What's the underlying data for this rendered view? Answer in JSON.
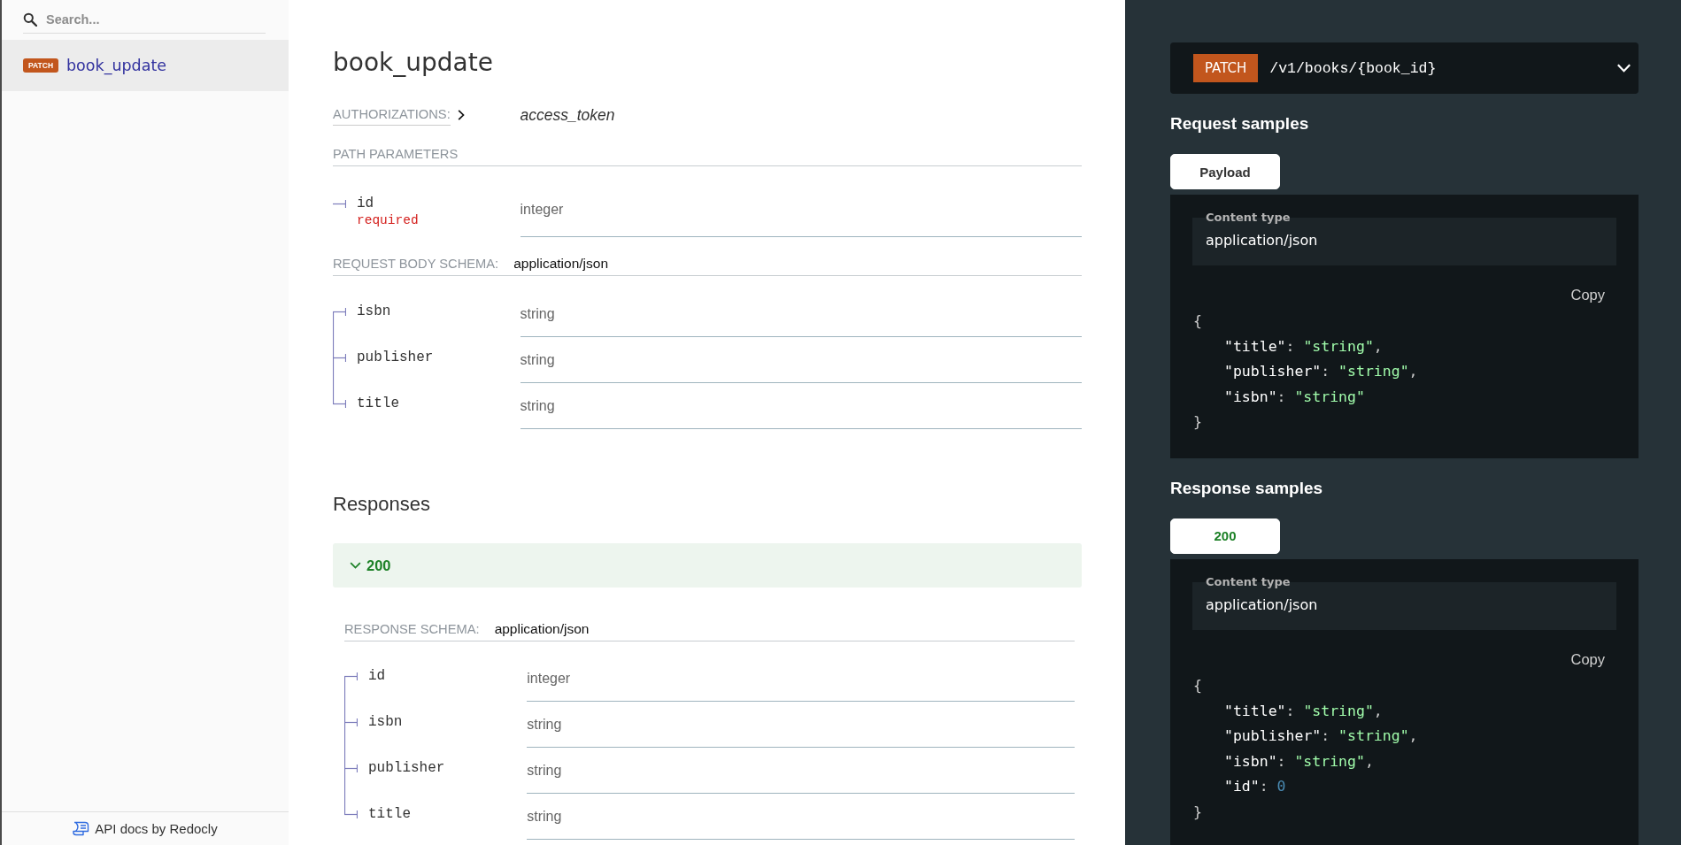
{
  "sidebar": {
    "search": {
      "placeholder": "Search..."
    },
    "items": [
      {
        "method": "PATCH",
        "label": "book_update",
        "selected": true
      }
    ],
    "footer": "API docs by Redocly"
  },
  "operation": {
    "title": "book_update",
    "authorizations": {
      "label": "AUTHORIZATIONS:",
      "value": "access_token"
    },
    "path_parameters": {
      "heading": "PATH PARAMETERS",
      "params": [
        {
          "name": "id",
          "flag": "required",
          "type": "integer"
        }
      ]
    },
    "request_body": {
      "label": "REQUEST BODY SCHEMA:",
      "content_type": "application/json",
      "fields": [
        {
          "name": "isbn",
          "type": "string"
        },
        {
          "name": "publisher",
          "type": "string"
        },
        {
          "name": "title",
          "type": "string"
        }
      ]
    },
    "responses": {
      "heading": "Responses",
      "items": [
        {
          "code": "200",
          "kind": "success",
          "expanded": true,
          "schema_label": "RESPONSE SCHEMA:",
          "content_type": "application/json",
          "fields": [
            {
              "name": "id",
              "type": "integer"
            },
            {
              "name": "isbn",
              "type": "string"
            },
            {
              "name": "publisher",
              "type": "string"
            },
            {
              "name": "title",
              "type": "string"
            }
          ]
        }
      ]
    }
  },
  "samples": {
    "endpoint": {
      "method": "PATCH",
      "path": "/v1/books/{book_id}"
    },
    "request": {
      "heading": "Request samples",
      "tabs": [
        {
          "label": "Payload",
          "kind": "plain",
          "selected": true
        }
      ],
      "content_type_label": "Content type",
      "content_type": "application/json",
      "copy": "Copy",
      "code": {
        "open": "{",
        "entries": [
          {
            "key": "\"title\"",
            "colon": ":",
            "value": "\"string\"",
            "kind": "string",
            "comma": ","
          },
          {
            "key": "\"publisher\"",
            "colon": ":",
            "value": "\"string\"",
            "kind": "string",
            "comma": ","
          },
          {
            "key": "\"isbn\"",
            "colon": ":",
            "value": "\"string\"",
            "kind": "string"
          }
        ],
        "close": "}"
      }
    },
    "response": {
      "heading": "Response samples",
      "tabs": [
        {
          "label": "200",
          "kind": "success",
          "selected": true
        }
      ],
      "content_type_label": "Content type",
      "content_type": "application/json",
      "copy": "Copy",
      "code": {
        "open": "{",
        "entries": [
          {
            "key": "\"title\"",
            "colon": ":",
            "value": "\"string\"",
            "kind": "string",
            "comma": ","
          },
          {
            "key": "\"publisher\"",
            "colon": ":",
            "value": "\"string\"",
            "kind": "string",
            "comma": ","
          },
          {
            "key": "\"isbn\"",
            "colon": ":",
            "value": "\"string\"",
            "kind": "string",
            "comma": ","
          },
          {
            "key": "\"id\"",
            "colon": ":",
            "value": "0",
            "kind": "number"
          }
        ],
        "close": "}"
      }
    }
  }
}
